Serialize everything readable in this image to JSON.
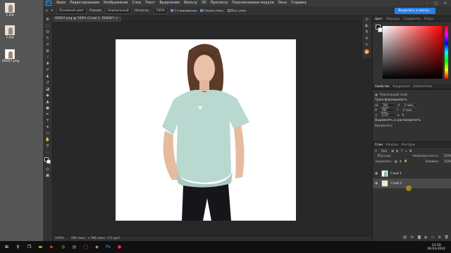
{
  "desktop": {
    "icons": [
      {
        "label": "1.jpg"
      },
      {
        "label": "2.jpg"
      },
      {
        "label": "00007.png"
      }
    ]
  },
  "menubar": {
    "logo": "Ps",
    "items": [
      "Файл",
      "Редактирование",
      "Изображение",
      "Слои",
      "Текст",
      "Выделение",
      "Фильтр",
      "3D",
      "Просмотр",
      "Подключаемые модули",
      "Окно",
      "Справка"
    ]
  },
  "options": {
    "mode_value": "Основной цвет",
    "mode_label": "Режим:",
    "mode_select": "Нормальный",
    "opacity_label": "Непрозр.:",
    "opacity_value": "100%",
    "smoothing_label": "Сглаживание",
    "contiguous_label": "Смежн.пикс.",
    "all_layers_label": "Все слои",
    "select_mask_button": "Выделить и маску..."
  },
  "document": {
    "tab": "00007.png @ 100% (Слой 2, RGB/8*) ×"
  },
  "status": {
    "zoom": "100%",
    "doc_size": "786 пикс. x 786 пикс. (72 ppi)"
  },
  "color_panel": {
    "tabs": [
      "Цвет",
      "Образцы",
      "Градиенты",
      "Узоры"
    ]
  },
  "properties": {
    "tabs": [
      "Свойства",
      "Коррекция",
      "Библиотеки"
    ],
    "layer_type": "Пиксельный слой",
    "transform_header": "Трансформировать",
    "w_value": "786 пикс.",
    "h_value": "786 пикс.",
    "x_value": "0 пикс.",
    "y_value": "0 пикс.",
    "angle_value": "0,00°",
    "align_header": "Выровнять и распределить",
    "align_label": "Выровнять:"
  },
  "layers_panel": {
    "tabs": [
      "Слои",
      "Каналы",
      "Контуры"
    ],
    "kind_label": "Вид",
    "blend_mode": "Обычные",
    "opacity_label": "Непрозрачность:",
    "opacity_value": "100%",
    "lock_label": "Закрепить:",
    "fill_label": "Заливка:",
    "fill_value": "100%",
    "layers": [
      {
        "name": "Слой 1",
        "selected": false
      },
      {
        "name": "Слой 2",
        "selected": true
      }
    ]
  },
  "taskbar": {
    "time": "23:19",
    "date": "28.03.2022"
  },
  "colors": {
    "accent": "#2680eb",
    "shirt": "#b8d8d0",
    "layer_fill": "#f6e7cf"
  }
}
